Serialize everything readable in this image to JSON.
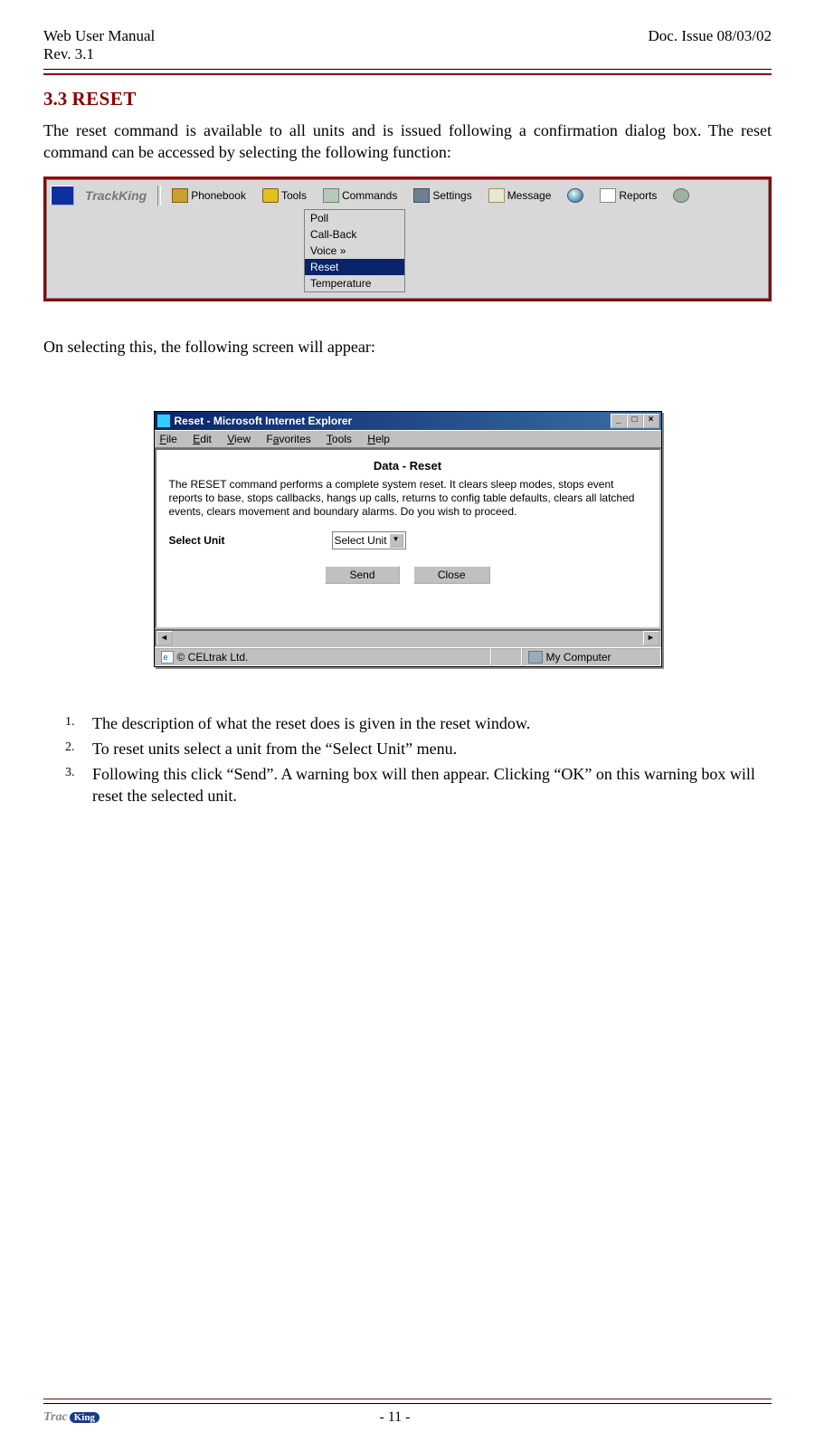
{
  "header": {
    "left_line1": "Web User Manual",
    "left_line2": "Rev. 3.1",
    "right": "Doc. Issue 08/03/02"
  },
  "section": {
    "number": "3.3",
    "title": "Reset",
    "intro": "The reset command is available to all units and is issued following a confirmation dialog box.  The reset command can be accessed by selecting the following function:",
    "bridge": "On selecting this, the following screen will appear:"
  },
  "fig1": {
    "brand": "TrackKing",
    "toolbar": {
      "phonebook": "Phonebook",
      "tools": "Tools",
      "commands": "Commands",
      "settings": "Settings",
      "message": "Message",
      "reports": "Reports"
    },
    "dropdown": {
      "items": [
        "Poll",
        "Call-Back",
        "Voice  »",
        "Reset",
        "Temperature"
      ],
      "selected_index": 3
    }
  },
  "fig2": {
    "title": "Reset - Microsoft Internet Explorer",
    "menus": {
      "file": "File",
      "edit": "Edit",
      "view": "View",
      "favorites": "Favorites",
      "tools": "Tools",
      "help": "Help"
    },
    "heading": "Data - Reset",
    "description": "The RESET command performs a complete system reset. It clears sleep modes, stops event reports to base, stops callbacks, hangs up calls, returns to config table defaults, clears all latched events, clears movement and boundary alarms. Do you wish to proceed.",
    "select_label": "Select Unit",
    "select_value": "Select Unit",
    "send": "Send",
    "close": "Close",
    "status_left": "© CELtrak Ltd.",
    "status_right": "My Computer"
  },
  "steps": [
    "The description of what the reset does is given in the reset window.",
    "To reset units select a unit from the “Select Unit” menu.",
    "Following this click “Send”.  A warning box will then appear.  Clicking “OK” on this warning box will reset the selected unit."
  ],
  "footer": {
    "logo_left": "Trac",
    "logo_right": "King",
    "page": "- 11 -"
  }
}
